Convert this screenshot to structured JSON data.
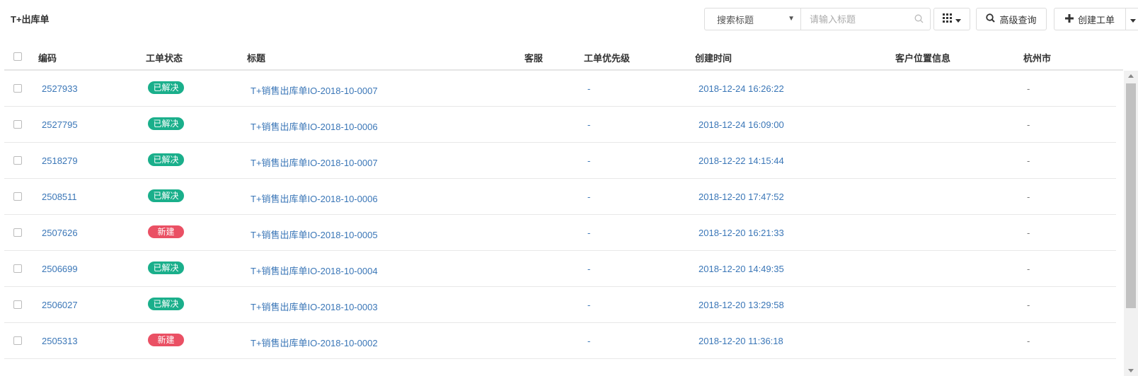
{
  "page_title": "T+出库单",
  "toolbar": {
    "search_field_label": "搜索标题",
    "search_placeholder": "请输入标题",
    "search_value": "",
    "advanced_search_label": "高级查询",
    "create_label": "创建工单"
  },
  "table": {
    "headers": {
      "code": "编码",
      "status": "工单状态",
      "title": "标题",
      "agent": "客服",
      "priority": "工单优先级",
      "created": "创建时间",
      "location": "客户位置信息",
      "city": "杭州市"
    },
    "rows": [
      {
        "code": "2527933",
        "status": "已解决",
        "status_type": "resolved",
        "title": "T+销售出库单IO-2018-10-0007",
        "agent": "",
        "priority": "-",
        "created": "2018-12-24 16:26:22",
        "location": "",
        "city": "-"
      },
      {
        "code": "2527795",
        "status": "已解决",
        "status_type": "resolved",
        "title": "T+销售出库单IO-2018-10-0006",
        "agent": "",
        "priority": "-",
        "created": "2018-12-24 16:09:00",
        "location": "",
        "city": "-"
      },
      {
        "code": "2518279",
        "status": "已解决",
        "status_type": "resolved",
        "title": "T+销售出库单IO-2018-10-0007",
        "agent": "",
        "priority": "-",
        "created": "2018-12-22 14:15:44",
        "location": "",
        "city": "-"
      },
      {
        "code": "2508511",
        "status": "已解决",
        "status_type": "resolved",
        "title": "T+销售出库单IO-2018-10-0006",
        "agent": "",
        "priority": "-",
        "created": "2018-12-20 17:47:52",
        "location": "",
        "city": "-"
      },
      {
        "code": "2507626",
        "status": "新建",
        "status_type": "new",
        "title": "T+销售出库单IO-2018-10-0005",
        "agent": "",
        "priority": "-",
        "created": "2018-12-20 16:21:33",
        "location": "",
        "city": "-"
      },
      {
        "code": "2506699",
        "status": "已解决",
        "status_type": "resolved",
        "title": "T+销售出库单IO-2018-10-0004",
        "agent": "",
        "priority": "-",
        "created": "2018-12-20 14:49:35",
        "location": "",
        "city": "-"
      },
      {
        "code": "2506027",
        "status": "已解决",
        "status_type": "resolved",
        "title": "T+销售出库单IO-2018-10-0003",
        "agent": "",
        "priority": "-",
        "created": "2018-12-20 13:29:58",
        "location": "",
        "city": "-"
      },
      {
        "code": "2505313",
        "status": "新建",
        "status_type": "new",
        "title": "T+销售出库单IO-2018-10-0002",
        "agent": "",
        "priority": "-",
        "created": "2018-12-20 11:36:18",
        "location": "",
        "city": "-"
      }
    ]
  },
  "colors": {
    "link": "#3a76b7",
    "resolved": "#1aaf8b",
    "new": "#ea5064"
  },
  "icons": {
    "dropdown": "caret-down-icon",
    "search": "search-icon",
    "columns": "grid-icon",
    "advanced_search": "search-icon",
    "create": "plus-icon"
  }
}
